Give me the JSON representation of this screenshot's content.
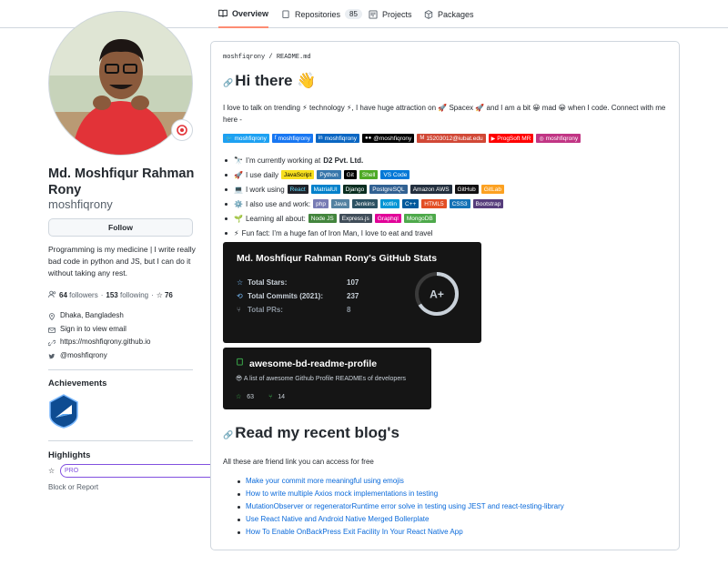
{
  "nav": {
    "tabs": [
      {
        "label": "Overview",
        "icon": "book-icon"
      },
      {
        "label": "Repositories",
        "icon": "repo-icon",
        "count": "85"
      },
      {
        "label": "Projects",
        "icon": "project-icon"
      },
      {
        "label": "Packages",
        "icon": "package-icon"
      }
    ]
  },
  "profile": {
    "name": "Md. Moshfiqur Rahman Rony",
    "login": "moshfiqrony",
    "follow_label": "Follow",
    "bio": "Programming is my medicine | I write really bad code in python and JS, but I can do it without taking any rest.",
    "followers_count": "64",
    "followers_label": "followers",
    "separator": "·",
    "following_count": "153",
    "following_label": "following",
    "stars_count": "76",
    "location": "Dhaka, Bangladesh",
    "email": "Sign in to view email",
    "website": "https://moshfiqrony.github.io",
    "twitter": "@moshfiqrony"
  },
  "sidebar": {
    "achievements_title": "Achievements",
    "highlights_title": "Highlights",
    "pro_label": "PRO",
    "block_label": "Block or Report"
  },
  "readme": {
    "path_user": "moshfiqrony",
    "path_sep": " / ",
    "path_file": "README.md",
    "h1": "Hi there 👋",
    "intro": "I love to talk on trending ⚡ technology ⚡, I have huge attraction on 🚀 Spacex 🚀 and I am a bit 😀 mad 😀 when I code. Connect with me here -",
    "social_badges": [
      {
        "text": "moshfiqrony",
        "color": "#1da1f2",
        "icon": "🐦"
      },
      {
        "text": "moshfiqrony",
        "color": "#1877f2",
        "icon": "f"
      },
      {
        "text": "moshfiqrony",
        "color": "#0a66c2",
        "icon": "in"
      },
      {
        "text": "@moshfiqrony",
        "color": "#000000",
        "icon": "●●"
      },
      {
        "text": "15203012@iubat.edu",
        "color": "#d14836",
        "icon": "M"
      },
      {
        "text": "ProgSoft MR",
        "color": "#ff0000",
        "icon": "▶"
      },
      {
        "text": "moshfiqrony",
        "color": "#c13584",
        "icon": "◎"
      }
    ],
    "bullets": [
      {
        "emoji": "🔭",
        "text": "I’m currently working at",
        "strong": "D2 Pvt. Ltd.",
        "badges": []
      },
      {
        "emoji": "🚀",
        "text": "I use daily",
        "strong": "",
        "badges": [
          {
            "text": "JavaScript",
            "color": "#f7df1e",
            "fg": "#000"
          },
          {
            "text": "Python",
            "color": "#3776ab",
            "fg": "#fff"
          },
          {
            "text": "Git",
            "color": "#000000",
            "fg": "#fff"
          },
          {
            "text": "Shell",
            "color": "#4eaa25",
            "fg": "#fff"
          },
          {
            "text": "VS Code",
            "color": "#0078d7",
            "fg": "#fff"
          }
        ]
      },
      {
        "emoji": "💻",
        "text": "I work using",
        "strong": "",
        "badges": [
          {
            "text": "React",
            "color": "#20232a",
            "fg": "#61dafb"
          },
          {
            "text": "MatrialUI",
            "color": "#0081cb",
            "fg": "#fff"
          },
          {
            "text": "Django",
            "color": "#092e20",
            "fg": "#fff"
          },
          {
            "text": "PostgreSQL",
            "color": "#316192",
            "fg": "#fff"
          },
          {
            "text": "Amazon AWS",
            "color": "#232f3e",
            "fg": "#fff"
          },
          {
            "text": "GitHub",
            "color": "#121011",
            "fg": "#fff"
          },
          {
            "text": "GitLab",
            "color": "#fca121",
            "fg": "#fff"
          }
        ]
      },
      {
        "emoji": "⚙️",
        "text": "I also use and work:",
        "strong": "",
        "badges": [
          {
            "text": "php",
            "color": "#777bb4",
            "fg": "#fff"
          },
          {
            "text": "Java",
            "color": "#5382a1",
            "fg": "#fff"
          },
          {
            "text": "Jenkins",
            "color": "#2c5263",
            "fg": "#fff"
          },
          {
            "text": "kotlin",
            "color": "#0095d5",
            "fg": "#fff"
          },
          {
            "text": "C++",
            "color": "#00599c",
            "fg": "#fff"
          },
          {
            "text": "HTML5",
            "color": "#e34f26",
            "fg": "#fff"
          },
          {
            "text": "CSS3",
            "color": "#1572b6",
            "fg": "#fff"
          },
          {
            "text": "Bootstrap",
            "color": "#563d7c",
            "fg": "#fff"
          }
        ]
      },
      {
        "emoji": "🌱",
        "text": "Learning all about:",
        "strong": "",
        "badges": [
          {
            "text": "Node JS",
            "color": "#43853d",
            "fg": "#fff"
          },
          {
            "text": "Express.js",
            "color": "#404d59",
            "fg": "#fff"
          },
          {
            "text": "Graphql",
            "color": "#e10098",
            "fg": "#fff"
          },
          {
            "text": "MongoDB",
            "color": "#4ea94b",
            "fg": "#fff"
          }
        ]
      },
      {
        "emoji": "⚡",
        "text": "Fun fact: I’m a huge fan of Iron Man, I love to eat and travel",
        "strong": "",
        "badges": []
      }
    ],
    "stats": {
      "title": "Md. Moshfiqur Rahman Rony's GitHub Stats",
      "rows": [
        {
          "icon": "☆",
          "label": "Total Stars:",
          "value": "107"
        },
        {
          "icon": "⟲",
          "label": "Total Commits (2021):",
          "value": "237"
        },
        {
          "icon": "⑂",
          "label": "Total PRs:",
          "value": "8"
        }
      ],
      "grade": "A+",
      "grade_fraction": 0.66
    },
    "pinned": {
      "title": "awesome-bd-readme-profile",
      "description": "😎 A list of awesome Github Profile READMEs of developers",
      "stars": "63",
      "forks": "14"
    },
    "h2": "Read my recent blog's",
    "blog_intro": "All these are friend link you can access for free",
    "blog_links": [
      "Make your commit more meaningful using emojis",
      "How to write multiple Axios mock implementations in testing",
      "MutationObserver or regeneratorRuntime error solve in testing using JEST and react-testing-library",
      "Use React Native and Android Native Merged Bollerplate",
      "How To Enable OnBackPress Exit Facility In Your React Native App"
    ]
  },
  "colors": {
    "accent": "#fd8c73",
    "link": "#0969da",
    "card": "#151515"
  }
}
